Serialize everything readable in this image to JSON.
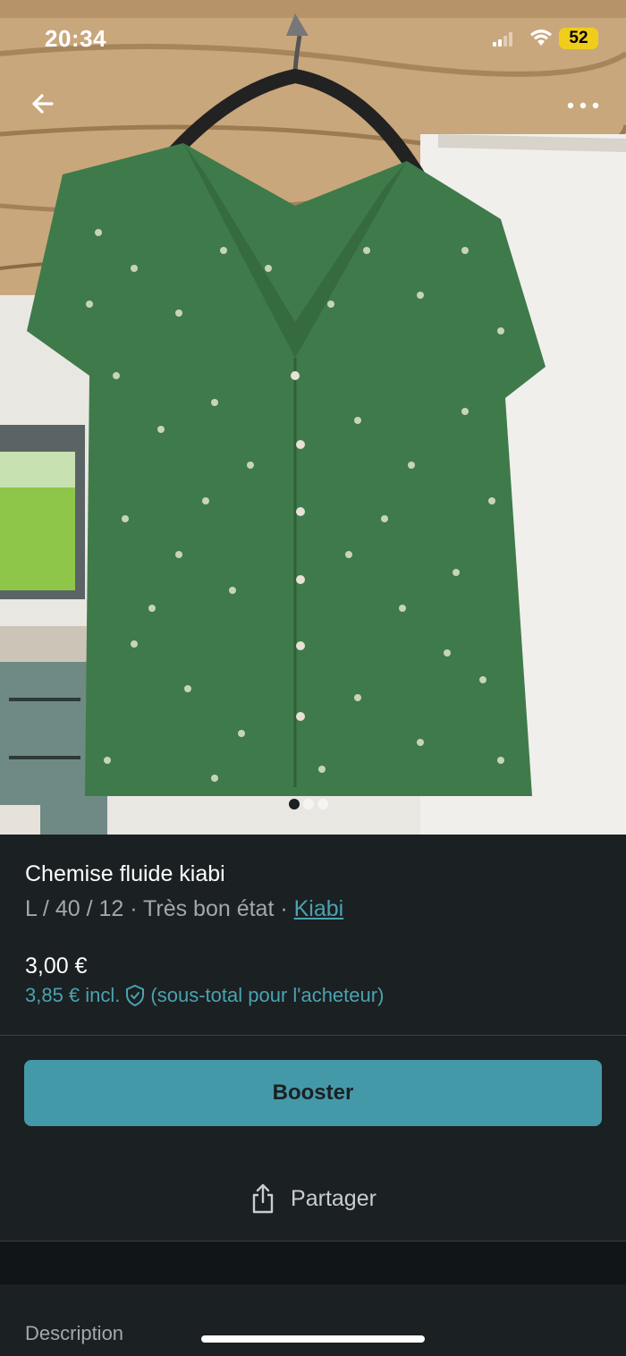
{
  "status_bar": {
    "time": "20:34",
    "battery": "52"
  },
  "photo": {
    "page_count": 3,
    "active_index": 0
  },
  "item": {
    "title": "Chemise fluide kiabi",
    "details": "L / 40 / 12 · Très bon état · ",
    "brand": "Kiabi",
    "price": "3,00 €",
    "price_incl": "3,85 € incl.",
    "price_incl_note": "(sous-total pour l'acheteur)"
  },
  "actions": {
    "booster": "Booster",
    "share": "Partager"
  },
  "description_label": "Description",
  "colors": {
    "background": "#1b2023",
    "accent": "#4499a8",
    "link": "#4aa3b0",
    "battery": "#f1cd1b"
  }
}
